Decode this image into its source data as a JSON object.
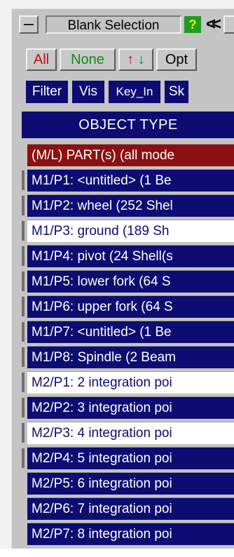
{
  "panel": {
    "title": "Blank Selection",
    "help_icon_text": "?",
    "collapse_icon_text": "<<"
  },
  "toolbar": {
    "all_label": "All",
    "none_label": "None",
    "sort_up_glyph": "↑",
    "sort_down_glyph": "↓",
    "opt_label": "Opt"
  },
  "toolbar2": {
    "filter_label": "Filter",
    "vis_label": "Vis",
    "keyin_label": "Key_In",
    "sk_label": "Sk"
  },
  "list": {
    "header": "OBJECT TYPE",
    "items": [
      {
        "label": "(M/L) PART(s) (all mode",
        "state": "hl"
      },
      {
        "label": "M1/P1: <untitled> (1 Be",
        "state": "sel"
      },
      {
        "label": "M1/P2: wheel (252 Shel",
        "state": "sel"
      },
      {
        "label": "M1/P3: ground (189 Sh",
        "state": "unsel"
      },
      {
        "label": "M1/P4: pivot (24 Shell(s",
        "state": "sel"
      },
      {
        "label": "M1/P5: lower fork (64 S",
        "state": "sel"
      },
      {
        "label": "M1/P6: upper fork (64 S",
        "state": "sel"
      },
      {
        "label": "M1/P7: <untitled> (1 Be",
        "state": "sel"
      },
      {
        "label": "M1/P8: Spindle (2 Beam",
        "state": "sel"
      },
      {
        "label": "M2/P1: 2 integration poi",
        "state": "unsel"
      },
      {
        "label": "M2/P2: 3 integration poi",
        "state": "sel"
      },
      {
        "label": "M2/P3: 4 integration poi",
        "state": "unsel"
      },
      {
        "label": "M2/P4: 5 integration poi",
        "state": "sel"
      },
      {
        "label": "M2/P5: 6 integration poi",
        "state": "sel"
      },
      {
        "label": "M2/P6: 7 integration poi",
        "state": "sel"
      },
      {
        "label": "M2/P7: 8 integration poi",
        "state": "sel"
      }
    ]
  },
  "colors": {
    "selected_bg": "#0c0c72",
    "unselected_bg": "#ffffff",
    "highlight_bg": "#8c1010",
    "panel_bg": "#c4c4c4"
  }
}
